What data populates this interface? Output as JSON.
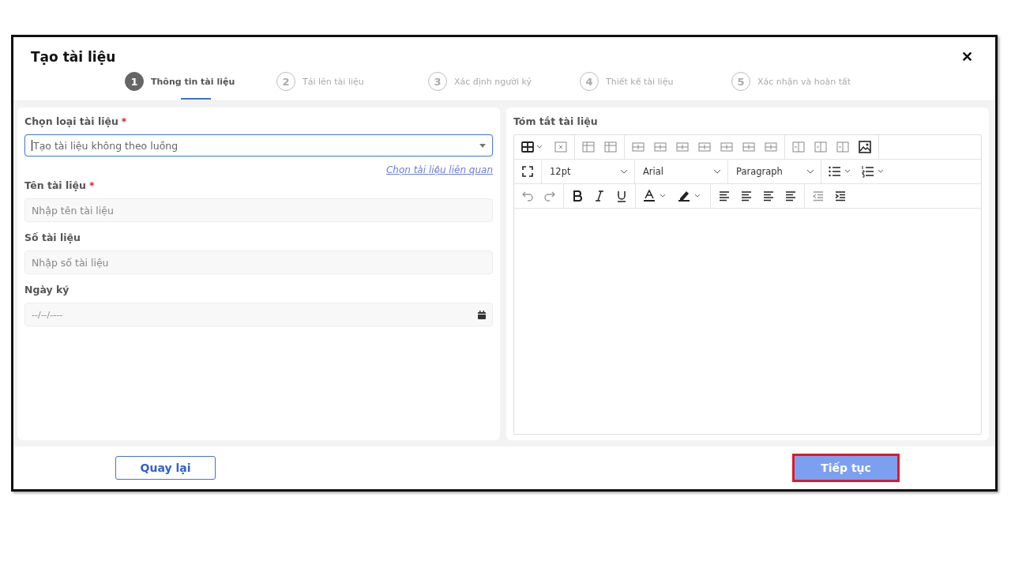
{
  "dialog": {
    "title": "Tạo tài liệu",
    "close": "✕"
  },
  "steps": [
    {
      "number": "1",
      "label": "Thông tin tài liệu",
      "selected": true
    },
    {
      "number": "2",
      "label": "Tải lên tài liệu",
      "selected": false
    },
    {
      "number": "3",
      "label": "Xác định người ký",
      "selected": false
    },
    {
      "number": "4",
      "label": "Thiết kế tài liệu",
      "selected": false
    },
    {
      "number": "5",
      "label": "Xác nhận và hoàn tất",
      "selected": false
    }
  ],
  "form": {
    "fields": [
      {
        "kind": "select",
        "label": "Chọn loại tài liệu",
        "required_mark": "*",
        "value": "Tạo tài liệu không theo luồng",
        "focused": true,
        "link": "Chọn tài liệu liên quan"
      },
      {
        "kind": "text",
        "label": "Tên tài liệu",
        "required_mark": "*",
        "placeholder": "Nhập tên tài liệu",
        "focused": false
      },
      {
        "kind": "text",
        "label": "Số tài liệu",
        "placeholder": "Nhập số tài liệu",
        "focused": false
      },
      {
        "kind": "date",
        "label": "Ngày ký",
        "placeholder": "--/--/----",
        "focused": false
      }
    ]
  },
  "editor": {
    "label": "Tóm tắt tài liệu",
    "font_size": "12pt",
    "font_family": "Arial",
    "block_format": "Paragraph"
  },
  "footer": {
    "back": "Quay lại",
    "next": {
      "label": "Tiếp tục",
      "highlighted": true
    }
  }
}
